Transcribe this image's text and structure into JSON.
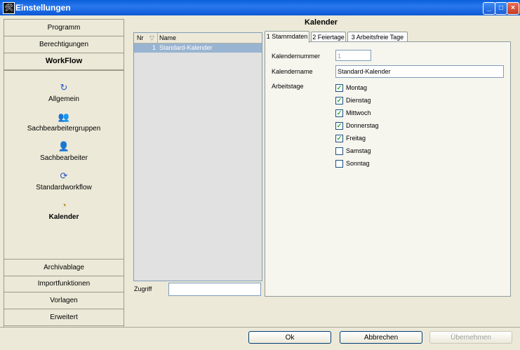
{
  "window": {
    "title": "Einstellungen",
    "app_icon_glyph": "🛠"
  },
  "sidebar": {
    "top_buttons": [
      {
        "label": "Programm"
      },
      {
        "label": "Berechtigungen"
      },
      {
        "label": "WorkFlow"
      }
    ],
    "items": [
      {
        "label": "Allgemein",
        "icon": "refresh-icon",
        "glyph": "↻"
      },
      {
        "label": "Sachbearbeitergruppen",
        "icon": "users-icon",
        "glyph": "👥"
      },
      {
        "label": "Sachbearbeiter",
        "icon": "user-icon",
        "glyph": "👤"
      },
      {
        "label": "Standardworkflow",
        "icon": "workflow-icon",
        "glyph": "⟳"
      },
      {
        "label": "Kalender",
        "icon": "calendar-icon",
        "glyph": "◔"
      }
    ],
    "bottom_buttons": [
      {
        "label": "Archivablage"
      },
      {
        "label": "Importfunktionen"
      },
      {
        "label": "Vorlagen"
      },
      {
        "label": "Erweitert"
      }
    ]
  },
  "main": {
    "heading": "Kalender",
    "list": {
      "columns": [
        "Nr",
        "Name"
      ],
      "rows": [
        {
          "nr": "1",
          "name": "Standard-Kalender"
        }
      ]
    },
    "zugriff_label": "Zugriff",
    "zugriff_value": "",
    "tabs": [
      {
        "label": "1 Stammdaten"
      },
      {
        "label": "2 Feiertage"
      },
      {
        "label": "3 Arbeitsfreie Tage"
      }
    ],
    "form": {
      "kalendernummer_label": "Kalendernummer",
      "kalendernummer_value": "1",
      "kalendername_label": "Kalendername",
      "kalendername_value": "Standard-Kalender",
      "arbeitstage_label": "Arbeitstage",
      "days": [
        {
          "label": "Montag",
          "checked": true
        },
        {
          "label": "Dienstag",
          "checked": true
        },
        {
          "label": "Mittwoch",
          "checked": true
        },
        {
          "label": "Donnerstag",
          "checked": true
        },
        {
          "label": "Freitag",
          "checked": true
        },
        {
          "label": "Samstag",
          "checked": false
        },
        {
          "label": "Sonntag",
          "checked": false
        }
      ]
    }
  },
  "buttons": {
    "ok": "Ok",
    "cancel": "Abbrechen",
    "apply": "Übernehmen"
  },
  "colors": {
    "titlebar": "#0a5fd8",
    "selection": "#99b4d1",
    "check": "#21a121"
  }
}
